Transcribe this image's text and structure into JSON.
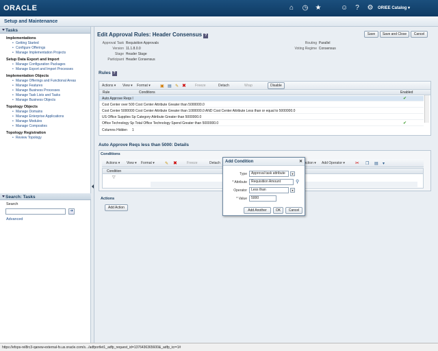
{
  "header": {
    "logo": "ORACLE",
    "catalog": "ORIEE Catalog ▾",
    "icons": [
      "home-icon",
      "clock-icon",
      "star-icon",
      "accessibility-icon",
      "help-icon",
      "gear-icon"
    ]
  },
  "subheader": {
    "title": "Setup and Maintenance"
  },
  "tasks": {
    "title": "Tasks",
    "sections": [
      {
        "heading": "Implementations",
        "links": [
          "Getting Started",
          "Configure Offerings",
          "Manage Implementation Projects"
        ]
      },
      {
        "heading": "Setup Data Export and Import",
        "links": [
          "Manage Configuration Packages",
          "Manage Export and Import Processes"
        ]
      },
      {
        "heading": "Implementation Objects",
        "links": [
          "Manage Offerings and Functional Areas",
          "Manage Features",
          "Manage Business Processes",
          "Manage Task Lists and Tasks",
          "Manage Business Objects"
        ]
      },
      {
        "heading": "Topology Objects",
        "links": [
          "Manage Domains",
          "Manage Enterprise Applications",
          "Manage Modules",
          "Manage Composites"
        ]
      },
      {
        "heading": "Topology Registration",
        "links": [
          "Review Topology"
        ]
      }
    ]
  },
  "search": {
    "title": "Search: Tasks",
    "label": "Search",
    "advanced": "Advanced"
  },
  "main": {
    "title": "Edit Approval Rules: Header Consensus",
    "save": "Save",
    "save_close": "Save and Close",
    "cancel": "Cancel",
    "info_left": [
      {
        "k": "Approval Task",
        "v": "Requisition Approvals"
      },
      {
        "k": "Version",
        "v": "11.1.8.0.0"
      },
      {
        "k": "Stage",
        "v": "Header Stage"
      },
      {
        "k": "Participant",
        "v": "Header Consensus"
      }
    ],
    "info_right": [
      {
        "k": "Routing",
        "v": "Parallel"
      },
      {
        "k": "Voting Regime",
        "v": "Consensus"
      }
    ],
    "rules_title": "Rules",
    "toolbar": {
      "actions": "Actions ▾",
      "view": "View ▾",
      "format": "Format ▾",
      "freeze": "Freeze",
      "detach": "Detach",
      "wrap": "Wrap",
      "disable": "Disable"
    },
    "rules_cols": {
      "rule": "Rule",
      "conditions": "Conditions",
      "enabled": "Enabled"
    },
    "rules": [
      {
        "text": "Auto Approve Reqs l",
        "enabled": "✔"
      },
      {
        "text": "Cost Center over 500 Cost Center Attribute Greater than 5000000.0",
        "enabled": ""
      },
      {
        "text": "Cost Center 5000000 Cost Center Attribute Greater than 1000000.0 AND Cost Center Attribute Less than or equal to 5000000.0",
        "enabled": ""
      },
      {
        "text": "US Office Supplies Sp Category Attribute Greater than 5000000.0",
        "enabled": ""
      },
      {
        "text": "Office Technology Sp Total Office Technology Spend Greater than 5000000.0",
        "enabled": "✔"
      }
    ],
    "columns_hidden_label": "Columns Hidden",
    "columns_hidden_value": "1",
    "details_title": "Auto Approve Reqs less than 5000: Details",
    "conditions_title": "Conditions",
    "cond_toolbar": {
      "actions": "Actions ▾",
      "view": "View ▾",
      "format": "Format ▾",
      "freeze": "Freeze",
      "detach": "Detach",
      "action": "Action ▾",
      "add_operator": "Add Operator ▾"
    },
    "cond_col": "Condition",
    "actions_title": "Actions",
    "add_action": "Add Action"
  },
  "dialog": {
    "title": "Add Condition",
    "type_label": "Type",
    "type_value": "Approval task attribute",
    "attribute_label": "* Attribute",
    "attribute_value": "Requisition Amount",
    "operator_label": "Operator",
    "operator_value": "Less than",
    "value_label": "* Value",
    "value_value": "5000",
    "add_another": "Add Another",
    "ok": "OK",
    "cancel": "Cancel"
  },
  "status": "https://efops-rel8rc3-qanew-external-fs.us.oracle.com/s.../adfportlet1_adfp_request_id=1376436365600&_adfp_icr=1#"
}
